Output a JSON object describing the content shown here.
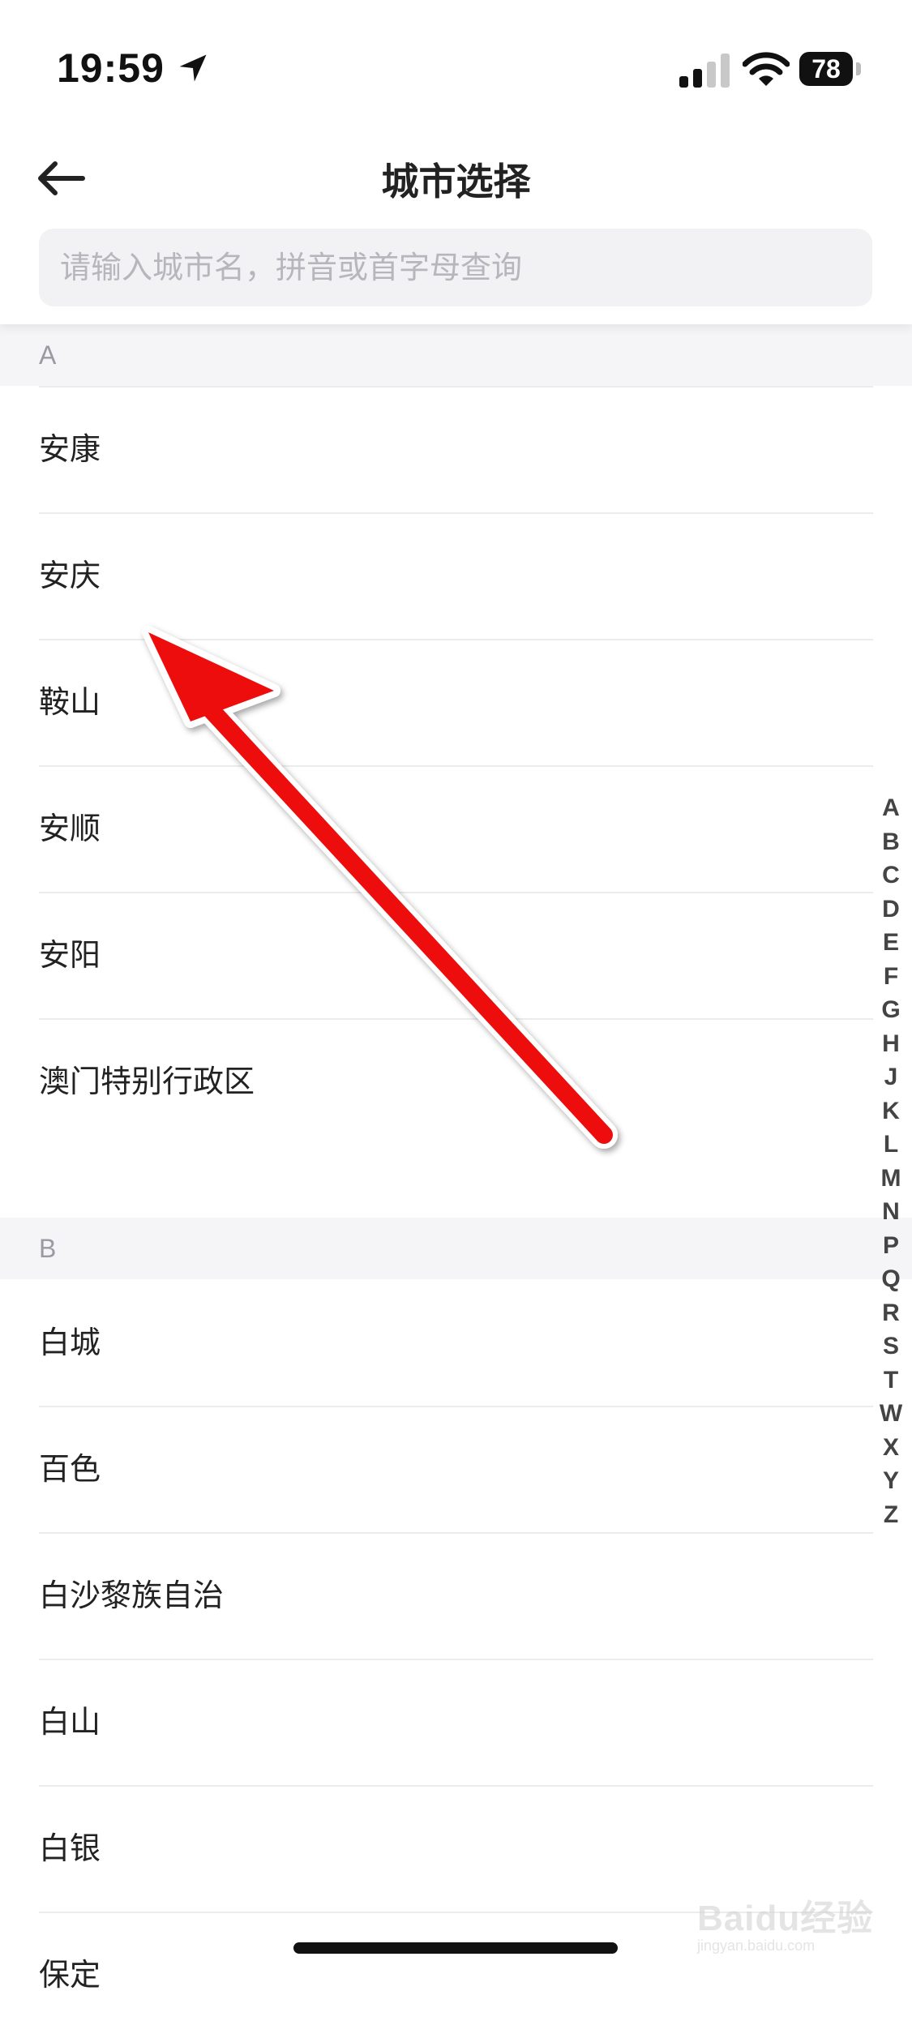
{
  "status_bar": {
    "time": "19:59",
    "battery": "78"
  },
  "header": {
    "title": "城市选择"
  },
  "search": {
    "placeholder": "请输入城市名，拼音或首字母查询"
  },
  "sections": [
    {
      "letter": "A",
      "cities": [
        "安康",
        "安庆",
        "鞍山",
        "安顺",
        "安阳",
        "澳门特别行政区"
      ]
    },
    {
      "letter": "B",
      "cities": [
        "白城",
        "百色",
        "白沙黎族自治",
        "白山",
        "白银",
        "保定"
      ]
    }
  ],
  "index_letters": [
    "A",
    "B",
    "C",
    "D",
    "E",
    "F",
    "G",
    "H",
    "J",
    "K",
    "L",
    "M",
    "N",
    "P",
    "Q",
    "R",
    "S",
    "T",
    "W",
    "X",
    "Y",
    "Z"
  ],
  "annotation": {
    "color": "#ee1111"
  },
  "watermark": {
    "brand": "Baidu经验",
    "url": "jingyan.baidu.com"
  }
}
